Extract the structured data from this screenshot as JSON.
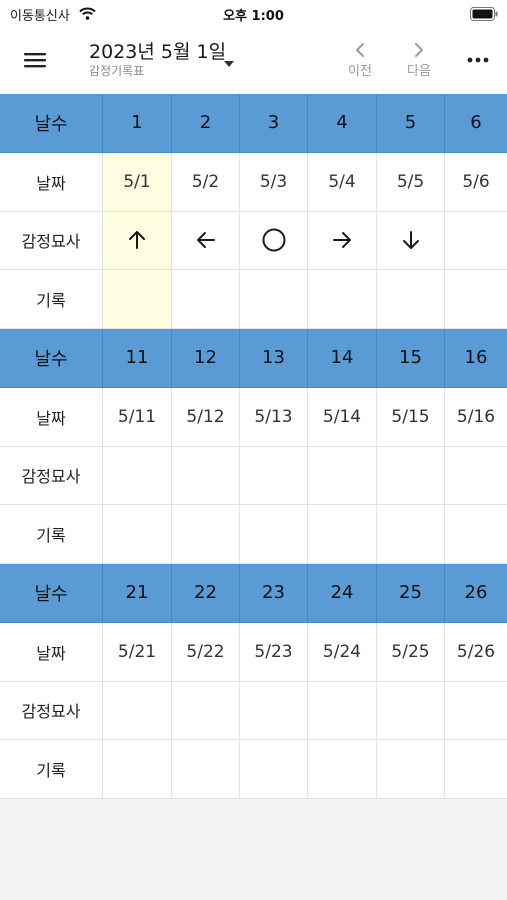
{
  "status_bar": {
    "carrier": "이동통신사",
    "time": "오후 1:00"
  },
  "header": {
    "title": "2023년 5월 1일",
    "subtitle": "감정기록표",
    "prev_label": "이전",
    "next_label": "다음"
  },
  "colors": {
    "header_row": "#5b9bd5",
    "today_highlight": "#fdfde1"
  },
  "weeks": [
    {
      "days_label": "날수",
      "date_label": "날짜",
      "mood_label": "감정묘사",
      "note_label": "기록",
      "days": [
        "1",
        "2",
        "3",
        "4",
        "5",
        "6"
      ],
      "dates": [
        "5/1",
        "5/2",
        "5/3",
        "5/4",
        "5/5",
        "5/6"
      ],
      "moods": [
        "↑",
        "←",
        "○",
        "→",
        "↓",
        ""
      ],
      "mood_icons": [
        "arrow-up-icon",
        "arrow-left-icon",
        "circle-icon",
        "arrow-right-icon",
        "arrow-down-icon",
        ""
      ]
    },
    {
      "days_label": "날수",
      "date_label": "날짜",
      "mood_label": "감정묘사",
      "note_label": "기록",
      "days": [
        "11",
        "12",
        "13",
        "14",
        "15",
        "16"
      ],
      "dates": [
        "5/11",
        "5/12",
        "5/13",
        "5/14",
        "5/15",
        "5/16"
      ],
      "moods": [
        "",
        "",
        "",
        "",
        "",
        ""
      ],
      "mood_icons": [
        "",
        "",
        "",
        "",
        "",
        ""
      ]
    },
    {
      "days_label": "날수",
      "date_label": "날짜",
      "mood_label": "감정묘사",
      "note_label": "기록",
      "days": [
        "21",
        "22",
        "23",
        "24",
        "25",
        "26"
      ],
      "dates": [
        "5/21",
        "5/22",
        "5/23",
        "5/24",
        "5/25",
        "5/26"
      ],
      "moods": [
        "",
        "",
        "",
        "",
        "",
        ""
      ],
      "mood_icons": [
        "",
        "",
        "",
        "",
        "",
        ""
      ]
    }
  ]
}
